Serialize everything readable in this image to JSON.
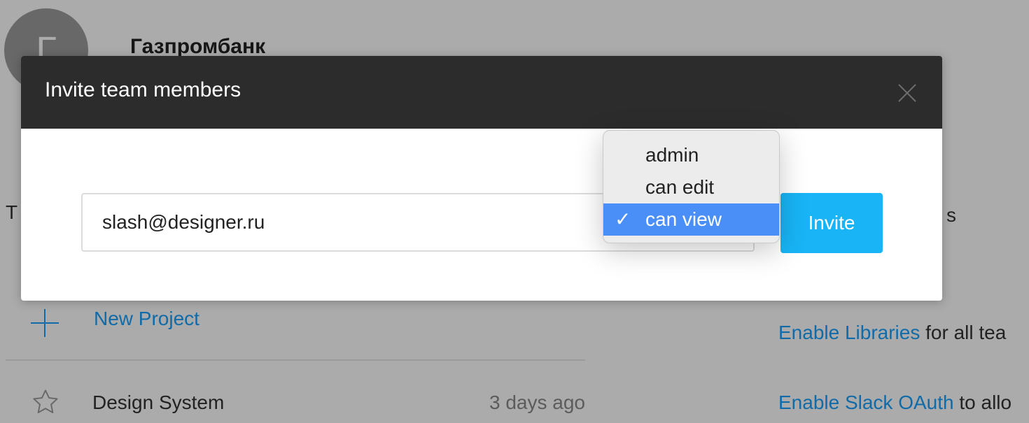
{
  "team": {
    "avatar_initial": "Г",
    "name": "Газпромбанк"
  },
  "background": {
    "left_heading_fragment": "T",
    "right_heading_fragment": "s",
    "new_project_label": "New Project",
    "projects": [
      {
        "name": "Design System",
        "updated": "3 days ago",
        "starred": false
      }
    ],
    "admin_links": [
      {
        "link": "Enable Libraries",
        "rest": " for all tea"
      },
      {
        "link": "Enable Slack OAuth",
        "rest": " to allo"
      }
    ]
  },
  "modal": {
    "title": "Invite team members",
    "email_value": "slash@designer.ru",
    "invite_label": "Invite",
    "role_options": [
      {
        "label": "admin",
        "selected": false
      },
      {
        "label": "can edit",
        "selected": false
      },
      {
        "label": "can view",
        "selected": true
      }
    ],
    "check_glyph": "✓"
  },
  "colors": {
    "accent": "#18a0fb",
    "invite_button": "#18b4f5",
    "header_bg": "#2c2c2c",
    "menu_highlight": "#4a8ff7"
  },
  "icons": {
    "plus": "plus-icon",
    "star": "star-outline-icon",
    "close": "close-icon",
    "check": "checkmark-icon"
  }
}
